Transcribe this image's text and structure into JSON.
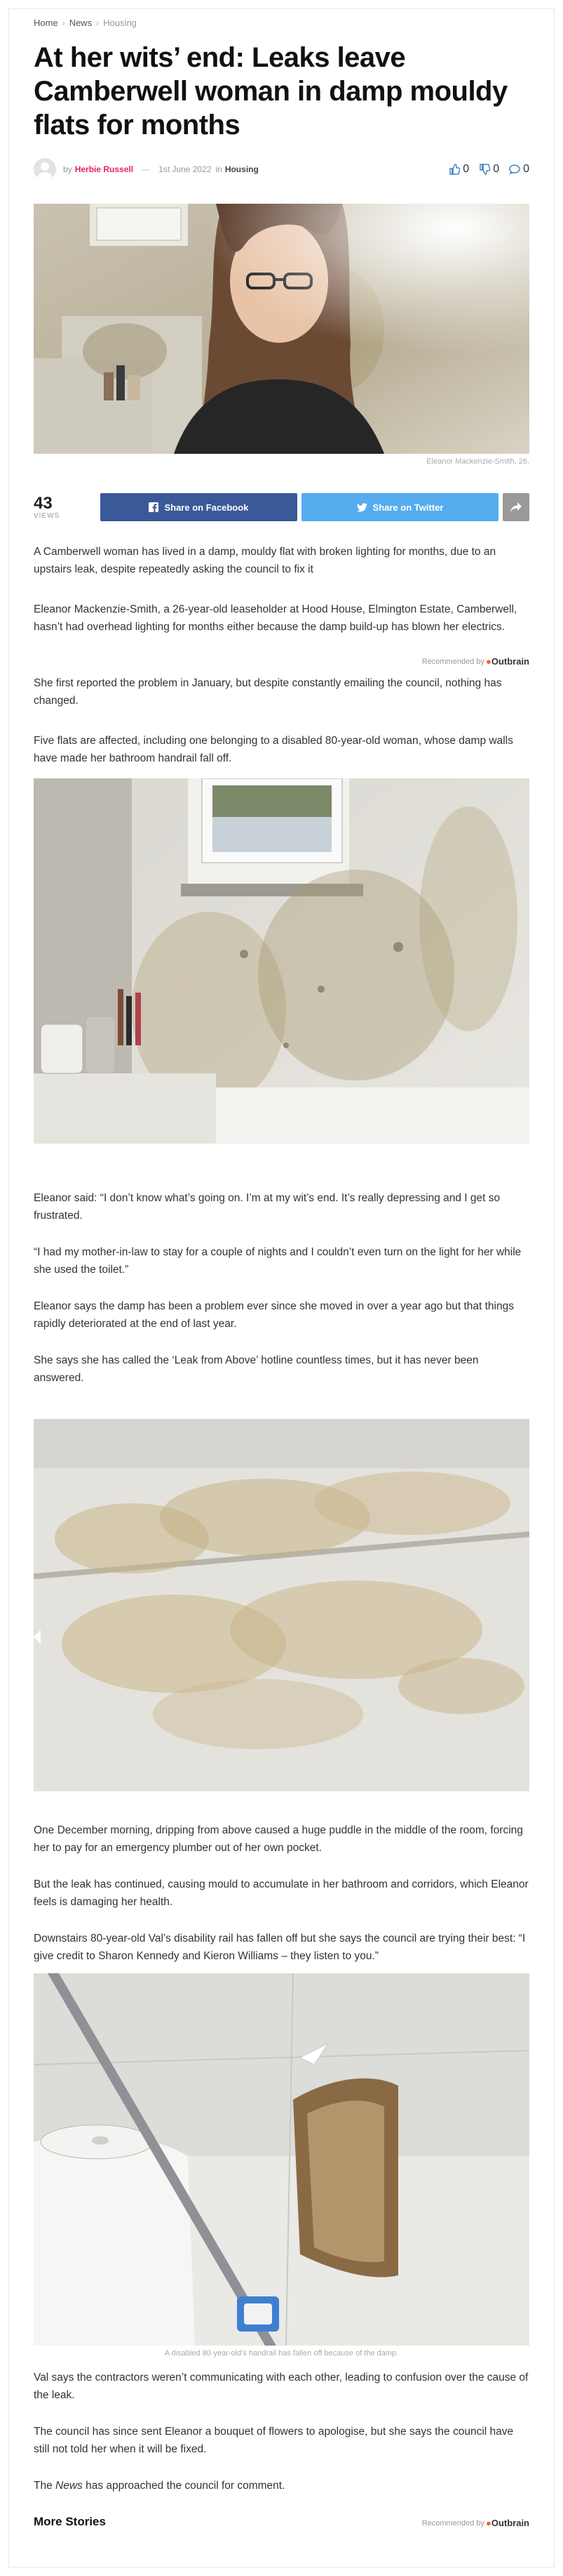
{
  "breadcrumb": {
    "home": "Home",
    "news": "News",
    "current": "Housing"
  },
  "article": {
    "title": "At her wits’ end: Leaks leave Camberwell woman in damp mouldy flats for months",
    "by": "by",
    "author": "Herbie Russell",
    "dash": "—",
    "date": "1st June 2022",
    "in": "in",
    "category": "Housing"
  },
  "votes": {
    "up": "0",
    "down": "0",
    "comments": "0"
  },
  "hero_caption": "Eleanor Mackenzie-Smith, 26.",
  "share": {
    "views_count": "43",
    "views_label": "VIEWS",
    "facebook_label": "Share on Facebook",
    "twitter_label": "Share on Twitter"
  },
  "recommended": {
    "label": "Recommended by",
    "brand": "Outbrain"
  },
  "paragraphs": [
    "A Camberwell woman has lived in a damp, mouldy flat with broken lighting for months, due to an upstairs leak, despite repeatedly asking the council to fix it",
    "Eleanor Mackenzie-Smith, a 26-year-old leaseholder at Hood House, Elmington Estate, Camberwell, hasn’t had overhead lighting for months either because the damp build-up has blown her electrics.",
    "She first reported the problem in January, but despite constantly emailing the council, nothing has changed.",
    "Five flats are affected, including one belonging to a disabled 80-year-old woman, whose damp walls have made her bathroom handrail fall off.",
    "Eleanor said: “I don’t know what’s going on. I’m at my wit’s end. It’s really depressing and I get so frustrated.",
    "“I had my mother-in-law to stay for a couple of nights and I couldn’t even turn on the light for her while she used the toilet.”",
    "Eleanor says the damp has been a problem ever since she moved in over a year ago but that things rapidly deteriorated at the end of last year.",
    "She says she has called the ‘Leak from Above’ hotline countless times, but it has never been answered.",
    "One December morning, dripping from above caused a huge puddle in the middle of the room, forcing her to pay for an emergency plumber out of her own pocket.",
    "But the leak has continued, causing mould to accumulate in her bathroom and corridors, which Eleanor feels is damaging her health.",
    "Downstairs 80-year-old Val’s  disability rail has fallen off but she says the council are trying their best: “I give credit to Sharon Kennedy and Kieron Williams – they listen to you.”",
    "Val says the contractors weren’t communicating with each other, leading to confusion over the cause of the leak.",
    "The council has since sent Eleanor a bouquet of flowers to apologise, but she says the council have still not told her when it will be fixed."
  ],
  "last_paragraph": {
    "prefix": "The ",
    "em": "News",
    "suffix": " has approached the council for comment."
  },
  "handrail_caption": "A disabled 80-year-old’s handrail has fallen off because of the damp.",
  "more_stories": "More Stories"
}
